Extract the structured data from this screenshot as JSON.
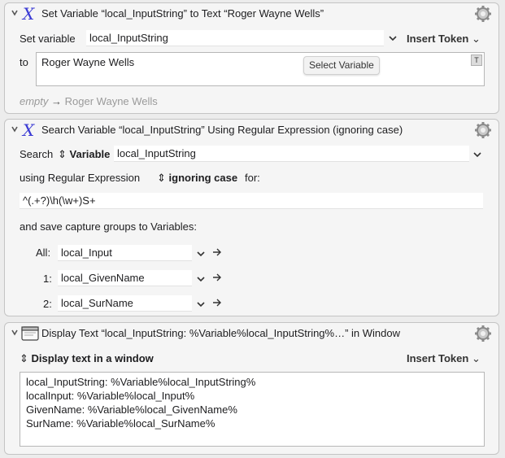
{
  "colors": {
    "accent_x": "#3b3bd4",
    "panel": "#f5f5f5",
    "border": "#c4c4c4",
    "muted": "#9a9a9a"
  },
  "action1": {
    "title": "Set Variable “local_InputString” to Text “Roger Wayne Wells”",
    "set_variable_label": "Set variable",
    "variable_value": "local_InputString",
    "insert_token": "Insert Token",
    "to_label": "to",
    "text_value": "Roger Wayne Wells",
    "select_variable_button": "Select Variable",
    "text_badge": "T",
    "result_before": "empty",
    "result_arrow": "→",
    "result_after": "Roger Wayne Wells"
  },
  "action2": {
    "title": "Search Variable “local_InputString” Using Regular Expression (ignoring case)",
    "search_label": "Search",
    "search_type": "Variable",
    "variable_value": "local_InputString",
    "using_label": "using Regular Expression",
    "case_mode": "ignoring case",
    "for_label": "for:",
    "regex_value": "^(.+?)\\h(\\w+)S+",
    "save_label": "and save capture groups to Variables:",
    "groups": [
      {
        "label": "All:",
        "value": "local_Input"
      },
      {
        "label": "1:",
        "value": "local_GivenName"
      },
      {
        "label": "2:",
        "value": "local_SurName"
      }
    ]
  },
  "action3": {
    "title": "Display Text “local_InputString: %Variable%local_InputString%…” in Window",
    "display_mode": "Display text in a window",
    "insert_token": "Insert Token",
    "lines": [
      "local_InputString: %Variable%local_InputString%",
      "localInput: %Variable%local_Input%",
      "GivenName: %Variable%local_GivenName%",
      "SurName: %Variable%local_SurName%"
    ]
  }
}
